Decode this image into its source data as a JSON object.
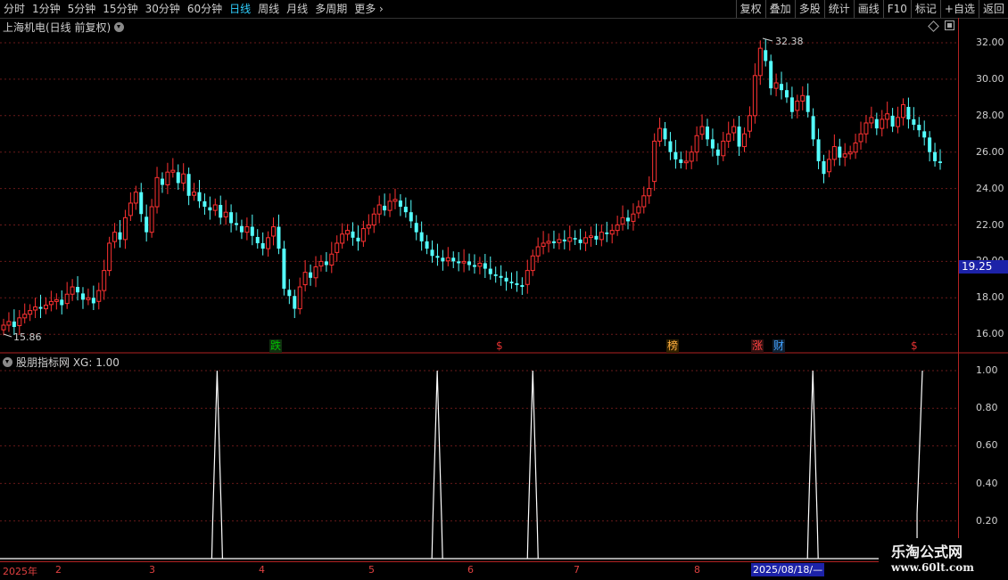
{
  "toolbar": {
    "periods": [
      "分时",
      "1分钟",
      "5分钟",
      "15分钟",
      "30分钟",
      "60分钟",
      "日线",
      "周线",
      "月线",
      "多周期",
      "更多"
    ],
    "active_period": "日线",
    "right_buttons": [
      "复权",
      "叠加",
      "多股",
      "统计",
      "画线",
      "F10",
      "标记",
      "+自选",
      "返回"
    ]
  },
  "main": {
    "title": "上海机电(日线 前复权)",
    "current_price": "19.25",
    "high_label": "32.38",
    "low_label": "15.86",
    "y_labels": [
      "32.00",
      "30.00",
      "28.00",
      "26.00",
      "24.00",
      "22.00",
      "20.00",
      "18.00",
      "16.00"
    ],
    "markers": [
      {
        "text": "跌",
        "color": "#00c000",
        "bg": "#103010"
      },
      {
        "text": "$",
        "color": "#e03030",
        "bg": ""
      },
      {
        "text": "榜",
        "color": "#ffb040",
        "bg": "#302000"
      },
      {
        "text": "涨",
        "color": "#ff4040",
        "bg": "#301010"
      },
      {
        "text": "财",
        "color": "#40a0ff",
        "bg": "#102030"
      },
      {
        "text": "$",
        "color": "#e03030",
        "bg": ""
      }
    ]
  },
  "indicator": {
    "title": "股朋指标网 XG: 1.00",
    "y_labels": [
      "1.00",
      "0.80",
      "0.60",
      "0.40",
      "0.20"
    ]
  },
  "dates": {
    "labels": [
      "2025年",
      "2",
      "3",
      "4",
      "5",
      "6",
      "7",
      "8",
      "2025/08/18/—"
    ]
  },
  "logo": {
    "line1": "乐淘公式网",
    "line2": "www.60lt.com"
  },
  "chart_data": {
    "type": "candlestick",
    "title": "上海机电(日线 前复权)",
    "ylim": [
      15,
      33
    ],
    "highest": 32.38,
    "lowest": 15.86,
    "last": 19.25,
    "closes": [
      16.5,
      16.7,
      16.4,
      16.9,
      17.1,
      17.3,
      17.5,
      17.4,
      17.6,
      17.8,
      17.9,
      17.6,
      18.2,
      18.6,
      18.3,
      17.9,
      18.0,
      17.7,
      18.4,
      19.5,
      21.0,
      21.6,
      21.2,
      22.4,
      23.2,
      23.8,
      22.6,
      21.6,
      23.0,
      24.6,
      24.2,
      24.9,
      25.0,
      24.3,
      24.8,
      23.6,
      23.8,
      23.3,
      23.0,
      22.8,
      23.1,
      22.4,
      22.7,
      22.1,
      22.0,
      21.6,
      21.9,
      21.4,
      21.0,
      20.7,
      21.3,
      21.9,
      20.7,
      18.5,
      18.1,
      17.4,
      18.6,
      19.4,
      19.1,
      19.7,
      20.0,
      19.8,
      20.4,
      21.0,
      21.5,
      21.7,
      21.3,
      21.1,
      21.8,
      22.0,
      22.6,
      23.1,
      22.8,
      23.3,
      23.4,
      23.0,
      22.7,
      22.2,
      21.6,
      21.1,
      20.7,
      20.3,
      20.2,
      20.0,
      20.2,
      20.0,
      19.9,
      20.0,
      19.8,
      19.7,
      19.9,
      19.6,
      19.3,
      19.2,
      19.1,
      18.9,
      18.8,
      18.7,
      18.6,
      19.5,
      20.3,
      20.8,
      21.0,
      21.1,
      21.0,
      21.2,
      21.1,
      21.3,
      21.2,
      21.0,
      21.3,
      21.4,
      21.2,
      21.6,
      21.5,
      21.7,
      22.0,
      22.4,
      22.2,
      22.6,
      23.0,
      23.6,
      24.0,
      26.6,
      27.3,
      26.7,
      26.0,
      25.6,
      25.4,
      25.5,
      26.0,
      26.9,
      27.4,
      26.7,
      26.2,
      25.8,
      26.6,
      27.0,
      27.4,
      26.3,
      27.0,
      28.0,
      30.2,
      31.7,
      31.0,
      29.5,
      29.8,
      29.4,
      29.0,
      28.2,
      28.8,
      29.1,
      28.2,
      26.7,
      25.5,
      24.8,
      25.6,
      26.3,
      25.7,
      25.9,
      26.0,
      26.5,
      27.0,
      27.6,
      27.9,
      27.3,
      27.8,
      28.1,
      27.4,
      27.9,
      28.6,
      27.8,
      27.5,
      27.2,
      26.8,
      26.0,
      25.5,
      25.4
    ],
    "xg_signal_positions": [
      0.228,
      0.463,
      0.565,
      0.864,
      0.981
    ],
    "xg_ylim": [
      0,
      1
    ]
  }
}
